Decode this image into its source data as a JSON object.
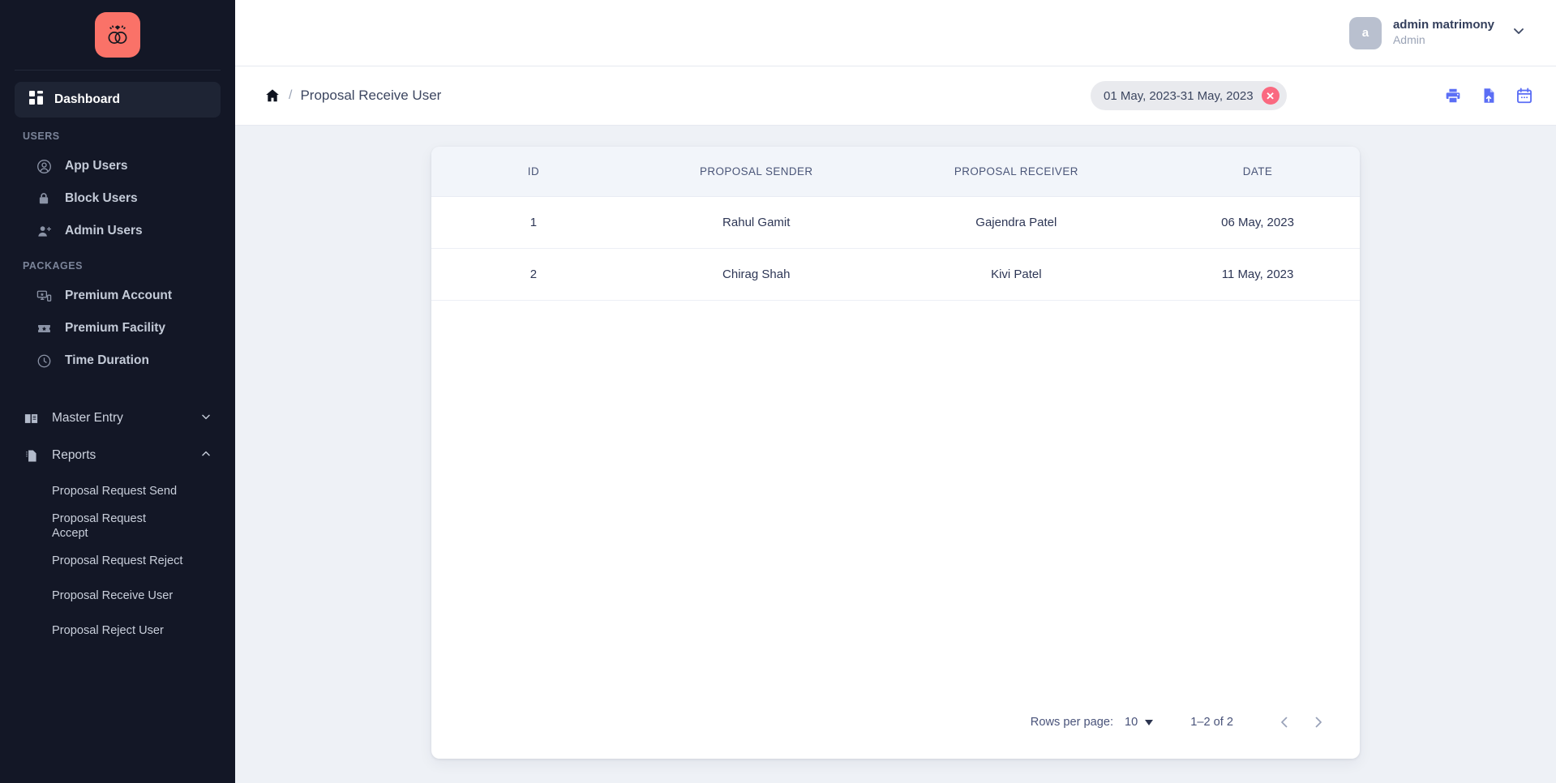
{
  "brand": {
    "logo_icon": "wedding-rings-icon",
    "logo_bg": "#fa7268"
  },
  "sidebar": {
    "dashboard": {
      "label": "Dashboard",
      "icon": "dashboard-grid-icon"
    },
    "sections": [
      {
        "title": "USERS",
        "items": [
          {
            "label": "App Users",
            "icon": "user-circle-icon"
          },
          {
            "label": "Block Users",
            "icon": "lock-icon"
          },
          {
            "label": "Admin Users",
            "icon": "user-add-icon"
          }
        ]
      },
      {
        "title": "PACKAGES",
        "items": [
          {
            "label": "Premium Account",
            "icon": "devices-star-icon"
          },
          {
            "label": "Premium Facility",
            "icon": "ticket-star-icon"
          },
          {
            "label": "Time Duration",
            "icon": "clock-icon"
          }
        ]
      }
    ],
    "groups": [
      {
        "label": "Master Entry",
        "icon": "book-icon",
        "chevron": "chevron-down-icon",
        "expanded": false,
        "children": []
      },
      {
        "label": "Reports",
        "icon": "document-icon",
        "chevron": "chevron-up-icon",
        "expanded": true,
        "children": [
          {
            "label": "Proposal Request Send"
          },
          {
            "label": "Proposal Request Accept"
          },
          {
            "label": "Proposal Request Reject"
          },
          {
            "label": "Proposal Receive User"
          },
          {
            "label": "Proposal Reject User"
          }
        ]
      }
    ]
  },
  "topbar": {
    "avatar_initial": "a",
    "user_name": "admin matrimony",
    "user_role": "Admin",
    "chevron": "chevron-down-icon"
  },
  "subbar": {
    "home_icon": "home-icon",
    "separator": "/",
    "page_title": "Proposal Receive User",
    "date_chip": {
      "label": "01 May, 2023-31 May, 2023",
      "clear_icon": "close-circle-icon"
    },
    "actions": [
      {
        "name": "print-icon",
        "title": "Print"
      },
      {
        "name": "export-file-icon",
        "title": "Export"
      },
      {
        "name": "calendar-icon",
        "title": "Date range"
      }
    ],
    "accent": "#5b6ef5"
  },
  "table": {
    "columns": [
      "ID",
      "PROPOSAL SENDER",
      "PROPOSAL RECEIVER",
      "DATE"
    ],
    "rows": [
      {
        "id": "1",
        "sender": "Rahul Gamit",
        "receiver": "Gajendra Patel",
        "date": "06 May, 2023"
      },
      {
        "id": "2",
        "sender": "Chirag Shah",
        "receiver": "Kivi Patel",
        "date": "11 May, 2023"
      }
    ]
  },
  "pagination": {
    "rows_per_page_label": "Rows per page:",
    "rows_per_page_value": "10",
    "range": "1–2 of 2",
    "prev_icon": "chevron-left-icon",
    "next_icon": "chevron-right-icon"
  }
}
